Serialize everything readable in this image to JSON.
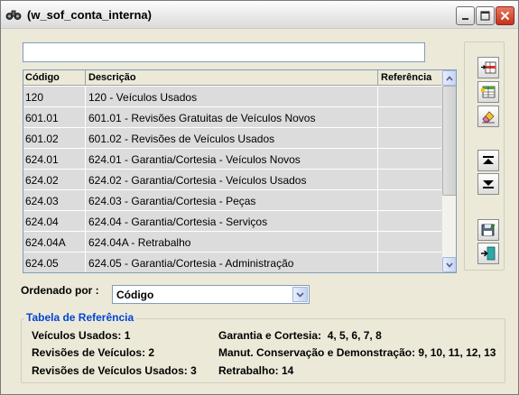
{
  "window": {
    "title": "(w_sof_conta_interna)"
  },
  "search": {
    "value": ""
  },
  "grid": {
    "columns": [
      "Código",
      "Descrição",
      "Referência"
    ],
    "rows": [
      {
        "codigo": "120",
        "descricao": "120 - Veículos Usados",
        "referencia": ""
      },
      {
        "codigo": "601.01",
        "descricao": "601.01 - Revisões Gratuitas de Veículos Novos",
        "referencia": ""
      },
      {
        "codigo": "601.02",
        "descricao": "601.02 - Revisões de Veículos Usados",
        "referencia": ""
      },
      {
        "codigo": "624.01",
        "descricao": "624.01 - Garantia/Cortesia - Veículos Novos",
        "referencia": ""
      },
      {
        "codigo": "624.02",
        "descricao": "624.02 - Garantia/Cortesia - Veículos Usados",
        "referencia": ""
      },
      {
        "codigo": "624.03",
        "descricao": "624.03 - Garantia/Cortesia - Peças",
        "referencia": ""
      },
      {
        "codigo": "624.04",
        "descricao": "624.04 - Garantia/Cortesia - Serviços",
        "referencia": ""
      },
      {
        "codigo": "624.04A",
        "descricao": "624.04A - Retrabalho",
        "referencia": ""
      },
      {
        "codigo": "624.05",
        "descricao": "624.05 - Garantia/Cortesia - Administração",
        "referencia": ""
      }
    ]
  },
  "order": {
    "label": "Ordenado por :",
    "selected": "Código"
  },
  "reference": {
    "legend": "Tabela de Referência",
    "left": [
      "Veículos Usados: 1",
      "Revisões de Veículos: 2",
      "Revisões de Veículos Usados: 3"
    ],
    "right": [
      "Garantia e Cortesia:  4, 5, 6, 7, 8",
      "Manut. Conservação e Demonstração: 9, 10, 11, 12, 13",
      "Retrabalho: 14"
    ]
  },
  "icons": {
    "window": "binoculars-icon",
    "toolbar": [
      "insert-row-icon",
      "edit-table-icon",
      "eraser-icon",
      "move-up-icon",
      "move-down-icon",
      "save-icon",
      "exit-icon"
    ]
  },
  "colors": {
    "accent": "#0046d5",
    "close_button": "#c4301a",
    "row_bg": "#dcdcdc"
  }
}
